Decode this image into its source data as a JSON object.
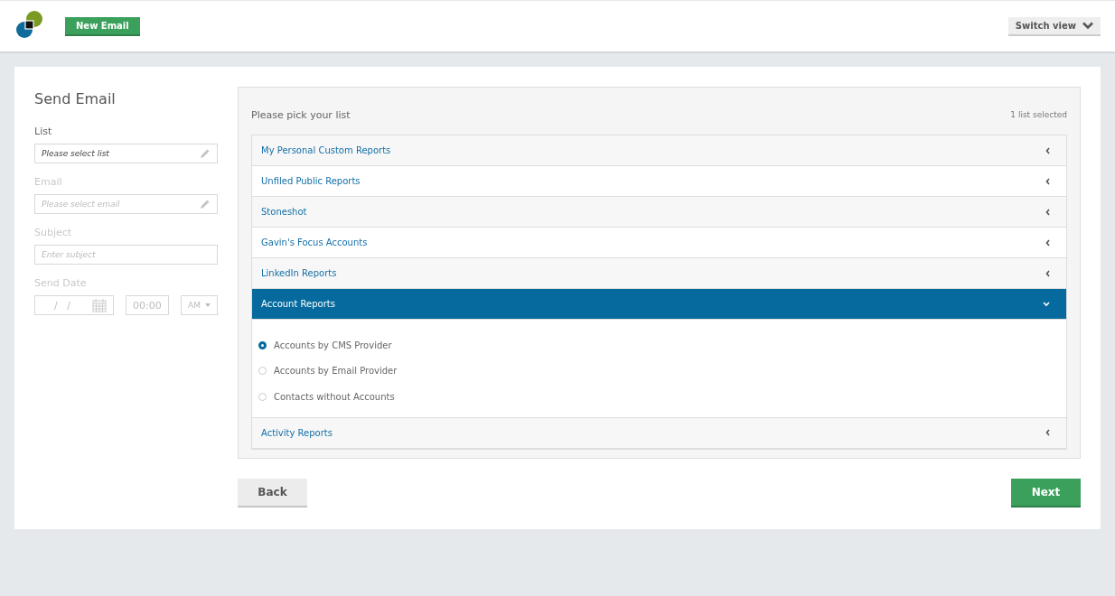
{
  "header": {
    "new_email_button": "New Email",
    "switch_view_button": "Switch view"
  },
  "form": {
    "title": "Send Email",
    "fields": [
      {
        "kind": "select",
        "label": "List",
        "placeholder": "Please select list",
        "disabled": false
      },
      {
        "kind": "select",
        "label": "Email",
        "placeholder": "Please select email",
        "disabled": true
      },
      {
        "kind": "text",
        "label": "Subject",
        "placeholder": "Enter subject",
        "disabled": true
      }
    ],
    "send_date": {
      "label": "Send Date",
      "disabled": true,
      "date_placeholder": "/   /",
      "time_placeholder": "00:00",
      "meridiem": "AM"
    }
  },
  "list_picker": {
    "prompt": "Please pick your list",
    "selection_count": "1 list selected",
    "groups": [
      {
        "label": "My Personal Custom Reports",
        "expanded": false,
        "selected": false
      },
      {
        "label": "Unfiled Public Reports",
        "expanded": false,
        "selected": false
      },
      {
        "label": "Stoneshot",
        "expanded": false,
        "selected": false
      },
      {
        "label": "Gavin's Focus Accounts",
        "expanded": false,
        "selected": false
      },
      {
        "label": "LinkedIn Reports",
        "expanded": false,
        "selected": false
      },
      {
        "label": "Account Reports",
        "expanded": true,
        "selected": true,
        "options": [
          {
            "label": "Accounts by CMS Provider",
            "selected": true
          },
          {
            "label": "Accounts by Email Provider",
            "selected": false
          },
          {
            "label": "Contacts without Accounts",
            "selected": false
          }
        ]
      },
      {
        "label": "Activity Reports",
        "expanded": false,
        "selected": false
      }
    ]
  },
  "footer": {
    "back_button": "Back",
    "next_button": "Next"
  }
}
